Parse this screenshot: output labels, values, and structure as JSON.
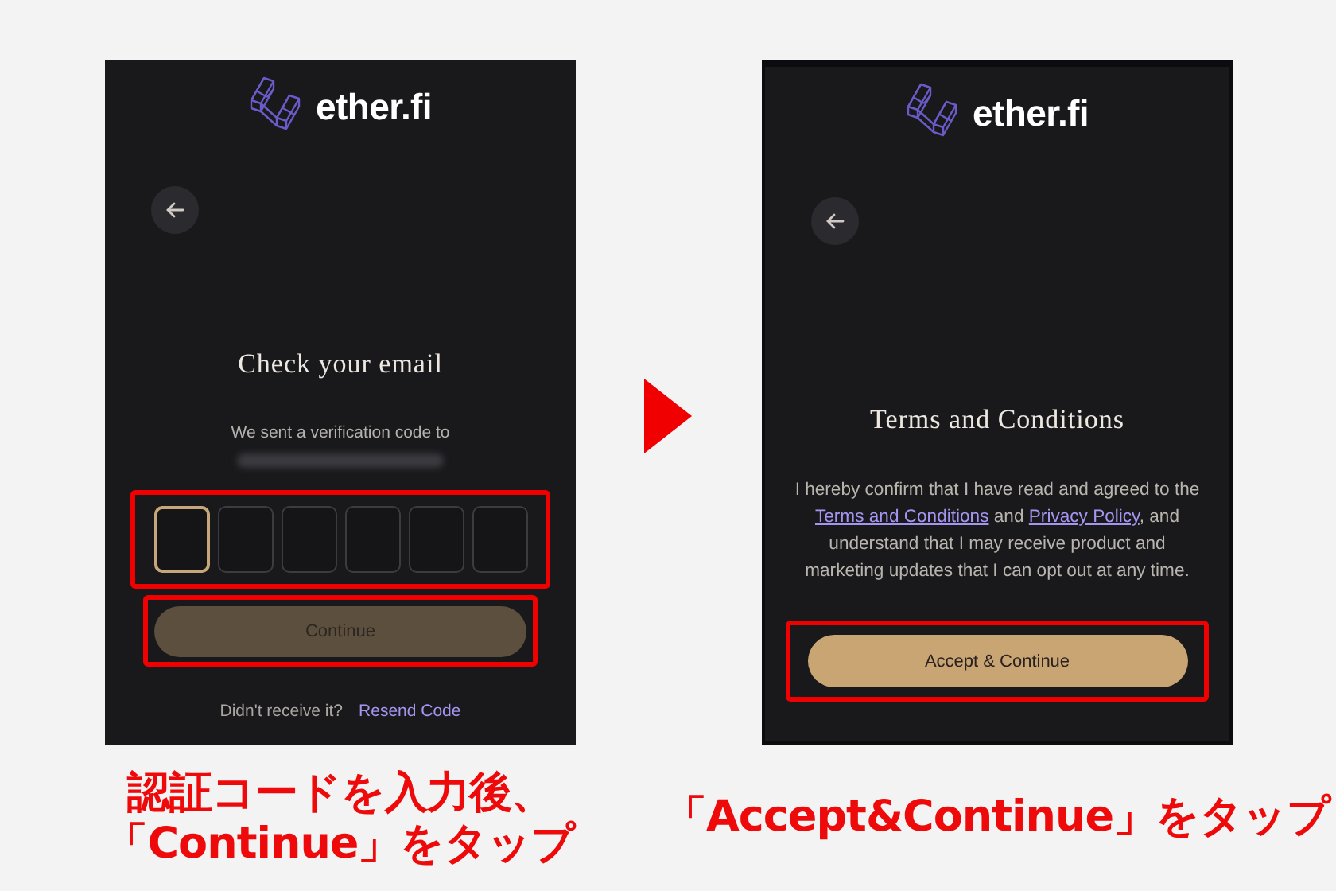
{
  "steps": [
    {
      "kind": "otp",
      "logo": "ether.fi",
      "title": "Check your email",
      "subtitle": "We sent a verification code to",
      "code_input": {
        "highlighted": true,
        "boxes": [
          {
            "focused": true
          },
          {
            "focused": false
          },
          {
            "focused": false
          },
          {
            "focused": false
          },
          {
            "focused": false
          },
          {
            "focused": false
          }
        ]
      },
      "button": {
        "label": "Continue",
        "disabled": true,
        "highlighted": true
      },
      "footer_prompt": "Didn't receive it?",
      "footer_link": "Resend Code",
      "caption": [
        "認証コードを入力後、",
        "「Continue」をタップ"
      ]
    },
    {
      "kind": "terms",
      "logo": "ether.fi",
      "title": "Terms and Conditions",
      "body": [
        {
          "text": "I hereby confirm that I have read and agreed to the ",
          "link": false
        },
        {
          "text": "Terms and Conditions",
          "link": true
        },
        {
          "text": " and ",
          "link": false
        },
        {
          "text": "Privacy Policy",
          "link": true
        },
        {
          "text": ", and understand that I may receive product and marketing updates that I can opt out at any time.",
          "link": false
        }
      ],
      "button": {
        "label": "Accept & Continue",
        "disabled": false,
        "highlighted": true
      },
      "caption": [
        "「Accept&Continue」をタップ"
      ]
    }
  ]
}
